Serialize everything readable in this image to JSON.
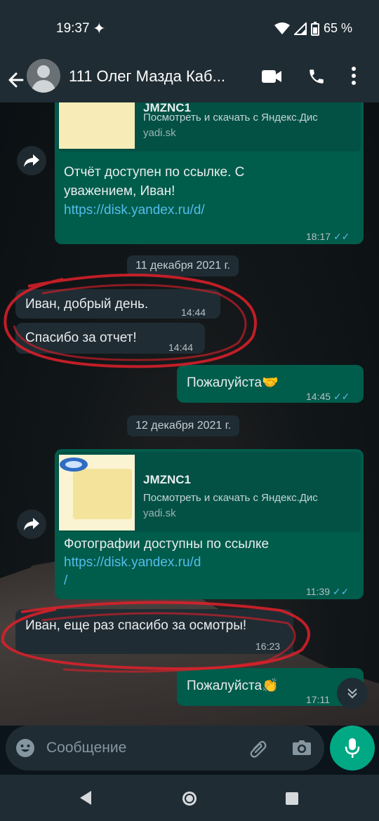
{
  "status_bar": {
    "time": "19:37",
    "battery": "65 %"
  },
  "header": {
    "contact_name": "111 Олег Мазда Каб..."
  },
  "messages": {
    "m1": {
      "preview_title": "JMZNC1",
      "preview_desc": "Посмотреть и скачать с Яндекс.Дис",
      "preview_domain": "yadi.sk",
      "text": "Отчёт доступен по ссылке. С уважением, Иван!",
      "link": "https://disk.yandex.ru/d/",
      "time": "18:17"
    },
    "date1": "11 декабря 2021 г.",
    "m2": {
      "text": "Иван, добрый день.",
      "time": "14:44"
    },
    "m3": {
      "text": "Спасибо за отчет!",
      "time": "14:44"
    },
    "m4": {
      "text": "Пожалуйста🤝",
      "time": "14:45"
    },
    "date2": "12 декабря 2021 г.",
    "m5": {
      "preview_title": "JMZNC1",
      "preview_desc": "Посмотреть и скачать с Яндекс.Дис",
      "preview_domain": "yadi.sk",
      "text": "Фотографии доступны по ссылке",
      "link_line1": "https://disk.yandex.ru/d",
      "link_line2": "/",
      "time": "11:39"
    },
    "m6": {
      "text": "Иван, еще раз спасибо за осмотры!",
      "time": "16:23"
    },
    "m7": {
      "text": "Пожалуйста👏",
      "time": "17:11"
    }
  },
  "composer": {
    "placeholder": "Сообщение"
  },
  "colors": {
    "outgoing_bubble": "#005c4b",
    "incoming_bubble": "#202c33",
    "accent": "#00a884",
    "read_ticks": "#53bdeb",
    "annotation_scribble": "#e0202a"
  },
  "icons": [
    "back-arrow-icon",
    "avatar",
    "video-call-icon",
    "phone-icon",
    "more-vert-icon",
    "forward-icon",
    "emoji-icon",
    "attach-icon",
    "camera-icon",
    "mic-icon",
    "chevron-double-down-icon"
  ]
}
